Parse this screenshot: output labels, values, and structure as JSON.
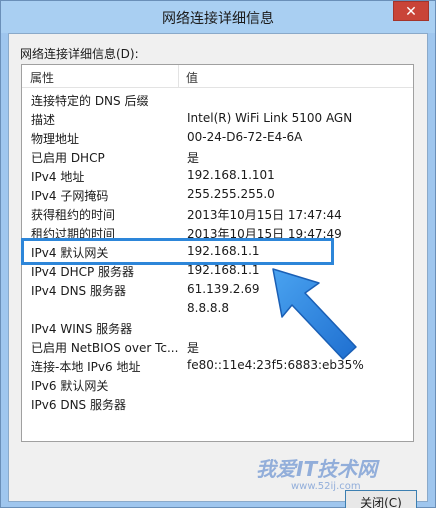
{
  "window": {
    "title": "网络连接详细信息",
    "close_glyph": "✕"
  },
  "group_label": "网络连接详细信息(D):",
  "columns": {
    "property": "属性",
    "value": "值"
  },
  "rows": [
    {
      "prop": "连接特定的 DNS 后缀",
      "val": ""
    },
    {
      "prop": "描述",
      "val": "Intel(R) WiFi Link 5100 AGN"
    },
    {
      "prop": "物理地址",
      "val": "00-24-D6-72-E4-6A"
    },
    {
      "prop": "已启用 DHCP",
      "val": "是"
    },
    {
      "prop": "IPv4 地址",
      "val": "192.168.1.101"
    },
    {
      "prop": "IPv4 子网掩码",
      "val": "255.255.255.0"
    },
    {
      "prop": "获得租约的时间",
      "val": "2013年10月15日 17:47:44"
    },
    {
      "prop": "租约过期的时间",
      "val": "2013年10月15日 19:47:49"
    },
    {
      "prop": "IPv4 默认网关",
      "val": "192.168.1.1"
    },
    {
      "prop": "IPv4 DHCP 服务器",
      "val": "192.168.1.1"
    },
    {
      "prop": "IPv4 DNS 服务器",
      "val": "61.139.2.69"
    },
    {
      "prop": "",
      "val": "8.8.8.8"
    },
    {
      "prop": "IPv4 WINS 服务器",
      "val": ""
    },
    {
      "prop": "已启用 NetBIOS over Tc...",
      "val": "是"
    },
    {
      "prop": "连接-本地 IPv6 地址",
      "val": "fe80::11e4:23f5:6883:eb35%"
    },
    {
      "prop": "IPv6 默认网关",
      "val": ""
    },
    {
      "prop": "IPv6 DNS 服务器",
      "val": ""
    }
  ],
  "close_button_label": "关闭(C)",
  "watermark": {
    "text": "我爱IT技术网",
    "url": "www.52ij.com"
  },
  "colors": {
    "highlight": "#2d86d9",
    "titlebar": "#a9cff2",
    "close": "#c94438"
  }
}
